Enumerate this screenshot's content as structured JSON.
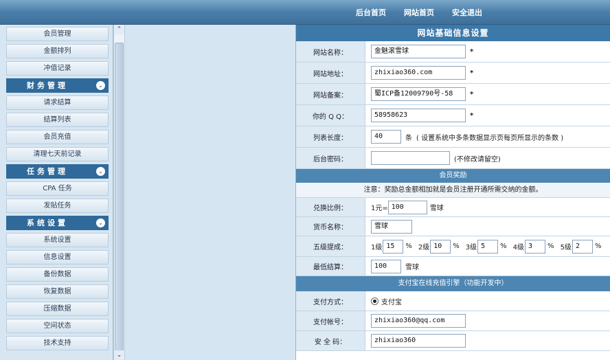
{
  "topnav": [
    "后台首页",
    "网站首页",
    "安全退出"
  ],
  "sidebar": [
    {
      "type": "item",
      "label": "会员管理"
    },
    {
      "type": "item",
      "label": "金额排列"
    },
    {
      "type": "item",
      "label": "冲值记录"
    },
    {
      "type": "head",
      "label": "财务管理",
      "toggle": "⌄"
    },
    {
      "type": "item",
      "label": "请求结算"
    },
    {
      "type": "item",
      "label": "结算列表"
    },
    {
      "type": "item",
      "label": "会员充值"
    },
    {
      "type": "item",
      "label": "清理七天前记录"
    },
    {
      "type": "head",
      "label": "任务管理",
      "toggle": "⌄"
    },
    {
      "type": "item",
      "label": "CPA 任务"
    },
    {
      "type": "item",
      "label": "发贴任务"
    },
    {
      "type": "head",
      "label": "系统设置",
      "toggle": "⌄"
    },
    {
      "type": "item",
      "label": "系统设置"
    },
    {
      "type": "item",
      "label": "信息设置"
    },
    {
      "type": "item",
      "label": "备份数据"
    },
    {
      "type": "item",
      "label": "恢复数据"
    },
    {
      "type": "item",
      "label": "压缩数据"
    },
    {
      "type": "item",
      "label": "空间状态"
    },
    {
      "type": "item",
      "label": "技术支持"
    }
  ],
  "scrollbar": {
    "up": "⌃",
    "down": "⌄"
  },
  "main": {
    "title": "网站基础信息设置",
    "site_name": {
      "label": "网站名称：",
      "value": "金魅滚雪球",
      "mark": "*"
    },
    "site_url": {
      "label": "网站地址：",
      "value": "zhixiao360.com",
      "mark": "*"
    },
    "site_icp": {
      "label": "网站备案：",
      "value": "蜀ICP备12009790号-58",
      "mark": "*"
    },
    "site_qq": {
      "label": "你的 Q Q：",
      "value": "58958623",
      "mark": "*"
    },
    "list_len": {
      "label": "列表长度：",
      "value": "40",
      "unit": "条",
      "note": "( 设置系统中多条数据显示页每页所显示的条数 )"
    },
    "admin_pw": {
      "label": "后台密码：",
      "value": "",
      "note": "(不修改请留空)"
    },
    "reward_title": "会员奖励",
    "reward_note": "注意：奖励总金额相加就是会员注册开通所需交纳的金额。",
    "ratio": {
      "label": "兑换比例：",
      "prefix": "1元=",
      "value": "100",
      "unit": "雪球"
    },
    "currency": {
      "label": "货币名称：",
      "value": "雪球"
    },
    "levels": {
      "label": "五级提成：",
      "items": [
        {
          "name": "1级",
          "value": "15",
          "unit": "%"
        },
        {
          "name": "2级",
          "value": "10",
          "unit": "%"
        },
        {
          "name": "3级",
          "value": "5",
          "unit": "%"
        },
        {
          "name": "4级",
          "value": "3",
          "unit": "%"
        },
        {
          "name": "5级",
          "value": "2",
          "unit": "%"
        }
      ]
    },
    "min_settle": {
      "label": "最低结算：",
      "value": "100",
      "unit": "雪球"
    },
    "pay_title": "支付宝在线充值引擎（功能开发中）",
    "pay_method": {
      "label": "支付方式：",
      "option": "支付宝"
    },
    "pay_account": {
      "label": "支付帐号：",
      "value": "zhixiao360@qq.com"
    },
    "pay_key": {
      "label": "安 全 码：",
      "value": "zhixiao360"
    }
  }
}
